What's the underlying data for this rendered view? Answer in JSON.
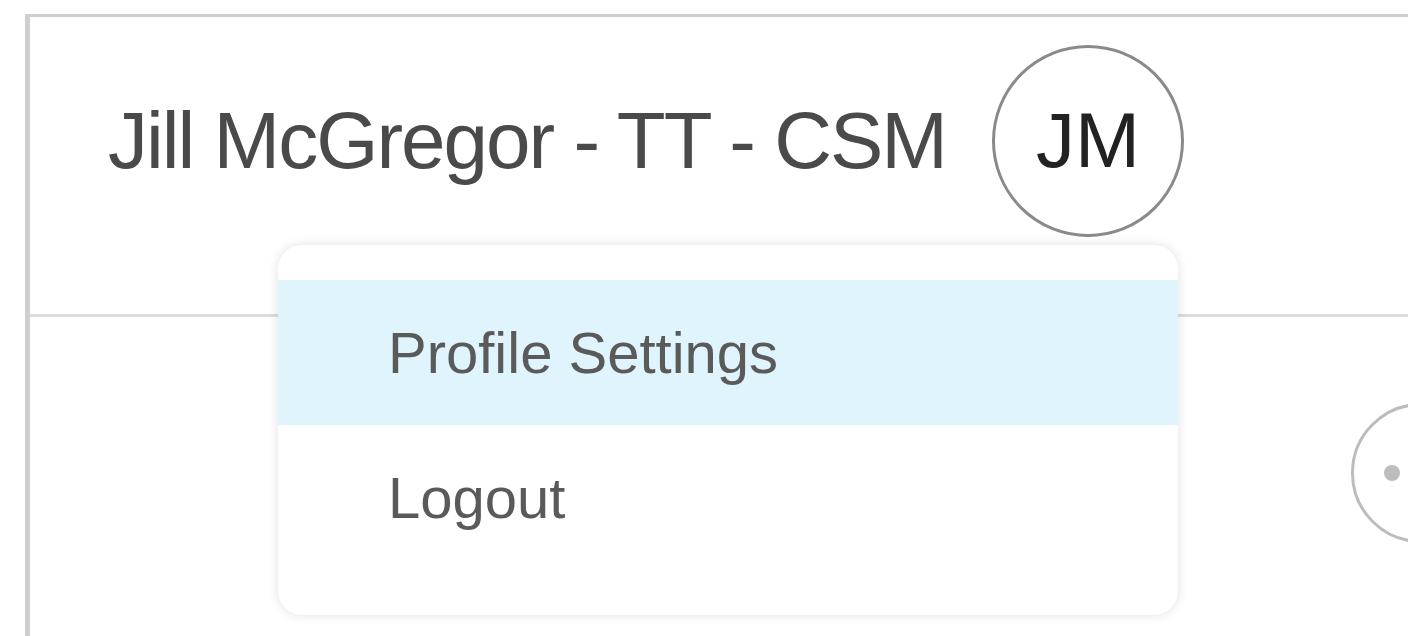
{
  "header": {
    "title": "Jill McGregor - TT - CSM",
    "avatar_initials": "JM"
  },
  "menu": {
    "items": [
      {
        "label": "Profile Settings",
        "selected": true
      },
      {
        "label": "Logout",
        "selected": false
      }
    ]
  }
}
